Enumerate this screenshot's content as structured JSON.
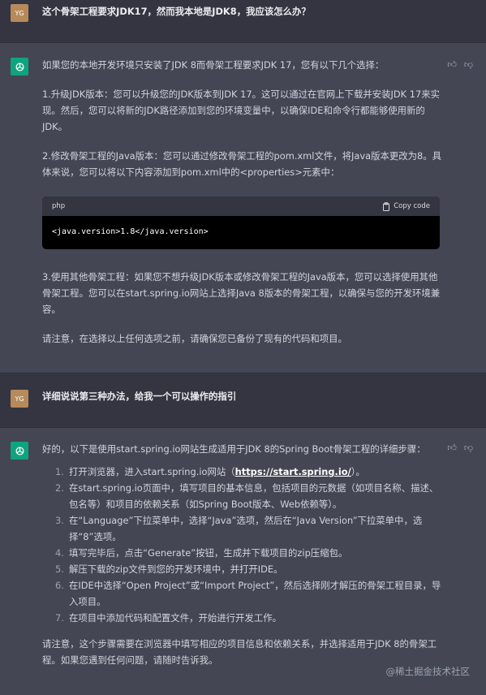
{
  "q1": {
    "avatar": "YG",
    "text": "这个骨架工程要求JDK17，然而我本地是JDK8，我应该怎么办？"
  },
  "a1": {
    "intro": "如果您的本地开发环境只安装了JDK 8而骨架工程要求JDK 17，您有以下几个选择：",
    "p1": "1.升级JDK版本：您可以升级您的JDK版本到JDK 17。这可以通过在官网上下载并安装JDK 17来实现。然后，您可以将新的JDK路径添加到您的环境变量中，以确保IDE和命令行都能够使用新的JDK。",
    "p2": "2.修改骨架工程的Java版本：您可以通过修改骨架工程的pom.xml文件，将Java版本更改为8。具体来说，您可以将以下内容添加到pom.xml中的<properties>元素中：",
    "code_lang": "php",
    "copy_label": "Copy code",
    "code": "<java.version>1.8</java.version>",
    "p3": "3.使用其他骨架工程：如果您不想升级JDK版本或修改骨架工程的Java版本，您可以选择使用其他骨架工程。您可以在start.spring.io网站上选择Java 8版本的骨架工程，以确保与您的开发环境兼容。",
    "p4": "请注意，在选择以上任何选项之前，请确保您已备份了现有的代码和项目。"
  },
  "q2": {
    "avatar": "YG",
    "text": "详细说说第三种办法，给我一个可以操作的指引"
  },
  "a2": {
    "intro": "好的，以下是使用start.spring.io网站生成适用于JDK 8的Spring Boot骨架工程的详细步骤：",
    "steps": [
      {
        "n": "1.",
        "text": "打开浏览器，进入start.spring.io网站（",
        "link": "https://start.spring.io/",
        "tail": "）。"
      },
      {
        "n": "2.",
        "text": "在start.spring.io页面中，填写项目的基本信息，包括项目的元数据（如项目名称、描述、包名等）和项目的依赖关系（如Spring Boot版本、Web依赖等）。"
      },
      {
        "n": "3.",
        "text": "在“Language”下拉菜单中，选择“Java”选项，然后在“Java Version”下拉菜单中，选择“8”选项。"
      },
      {
        "n": "4.",
        "text": "填写完毕后，点击“Generate”按钮，生成并下载项目的zip压缩包。"
      },
      {
        "n": "5.",
        "text": "解压下载的zip文件到您的开发环境中，并打开IDE。"
      },
      {
        "n": "6.",
        "text": "在IDE中选择“Open Project”或“Import Project”，然后选择刚才解压的骨架工程目录，导入项目。"
      },
      {
        "n": "7.",
        "text": "在项目中添加代码和配置文件，开始进行开发工作。"
      }
    ],
    "outro": "请注意，这个步骤需要在浏览器中填写相应的项目信息和依赖关系，并选择适用于JDK 8的骨架工程。如果您遇到任何问题，请随时告诉我。"
  },
  "watermark": "@稀土掘金技术社区",
  "icons": {
    "thumbs_up": "thumbs-up-icon",
    "thumbs_down": "thumbs-down-icon",
    "copy": "clipboard-icon",
    "gpt": "openai-logo-icon"
  },
  "colors": {
    "bg": "#343541",
    "assistant_bg": "#444654",
    "gpt_green": "#10a37f",
    "user_avatar": "#b68a5a"
  }
}
